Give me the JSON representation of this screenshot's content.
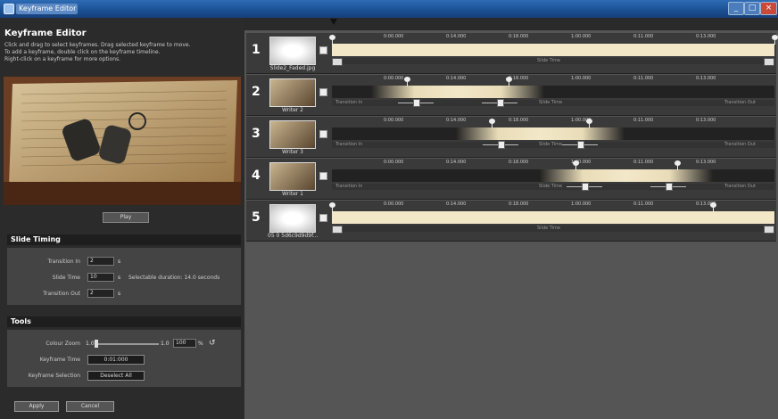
{
  "window": {
    "title": "Keyframe Editor",
    "minimize": "_",
    "maximize": "□",
    "close": "×"
  },
  "left": {
    "heading": "Keyframe Editor",
    "help": [
      "Click and drag to select keyframes. Drag selected keyframe to move.",
      "To add a keyframe, double click on the keyframe timeline.",
      "Right-click on a keyframe for more options."
    ],
    "play_label": "Play",
    "slide_timing": {
      "heading": "Slide Timing",
      "transition_in_label": "Transition In",
      "transition_in": "2",
      "slide_time_label": "Slide Time",
      "slide_time": "10",
      "transition_out_label": "Transition Out",
      "transition_out": "2",
      "unit": "s",
      "summary": "Selectable duration: 14.0 seconds"
    },
    "tools": {
      "heading": "Tools",
      "color_zoom_label": "Colour Zoom",
      "zoom_min": "1.0",
      "zoom_max": "1.0",
      "zoom_value": "100",
      "zoom_unit": "%",
      "reset_icon": "reset-icon",
      "keyframe_time_label": "Keyframe Time",
      "keyframe_time": "0:01:000",
      "keyframe_selection_label": "Keyframe Selection",
      "keyframe_selection": "Deselect All"
    },
    "apply_label": "Apply",
    "cancel_label": "Cancel"
  },
  "timeline": {
    "tick_labels": [
      "0:00.000",
      "0:14.000",
      "0:18.000",
      "1:00.000",
      "0:11.000",
      "0:13.000"
    ],
    "rows": [
      {
        "number": "1",
        "thumb_name": "Slide2_Faded.jpg",
        "kind": "slide-image",
        "keyframes": [
          0,
          100
        ],
        "captions": [
          "Slide Time"
        ],
        "end_buttons": true
      },
      {
        "number": "2",
        "thumb_name": "Writer 2",
        "kind": "transition",
        "keyframes": [
          17,
          40
        ],
        "captions": [
          "Transition In",
          "Slide Time",
          "Transition Out"
        ],
        "end_buttons": false
      },
      {
        "number": "3",
        "thumb_name": "Writer 3",
        "kind": "transition",
        "keyframes": [
          36,
          58
        ],
        "captions": [
          "Transition In",
          "Slide Time",
          "Transition Out"
        ],
        "end_buttons": false
      },
      {
        "number": "4",
        "thumb_name": "Writer 1",
        "kind": "transition",
        "keyframes": [
          55,
          78
        ],
        "captions": [
          "Transition In",
          "Slide Time",
          "Transition Out"
        ],
        "end_buttons": false
      },
      {
        "number": "5",
        "thumb_name": "05 0 5d6c9d9d9f...",
        "kind": "slide-image",
        "keyframes": [
          0,
          86
        ],
        "captions": [
          "Slide Time"
        ],
        "end_buttons": true
      }
    ]
  },
  "colors": {
    "accent": "#2d6bb5",
    "track_light": "#f2e8c8",
    "panel": "#2b2b2b"
  }
}
